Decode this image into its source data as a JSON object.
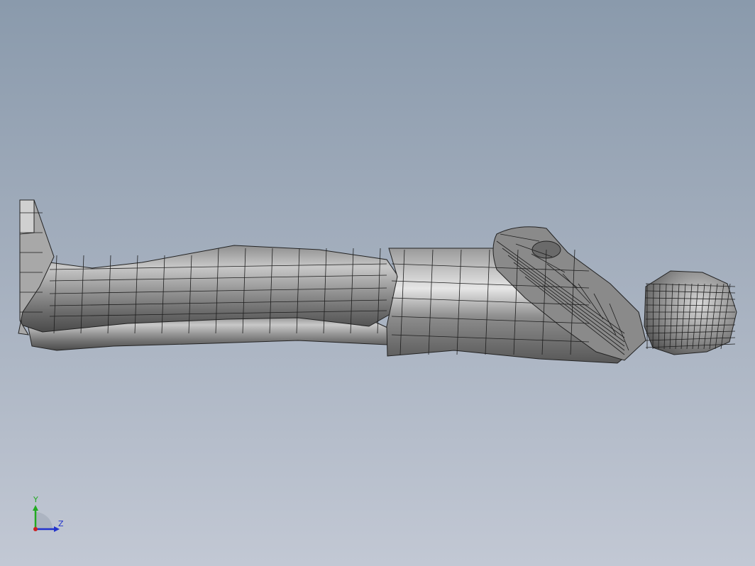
{
  "viewport": {
    "background_top": "#8a9aac",
    "background_bottom": "#c2c8d4",
    "model": "reclining-human-figure-mesh"
  },
  "triad": {
    "y_label": "Y",
    "z_label": "Z",
    "y_color": "#22aa22",
    "z_color": "#2233cc",
    "x_color": "#cc2222"
  }
}
